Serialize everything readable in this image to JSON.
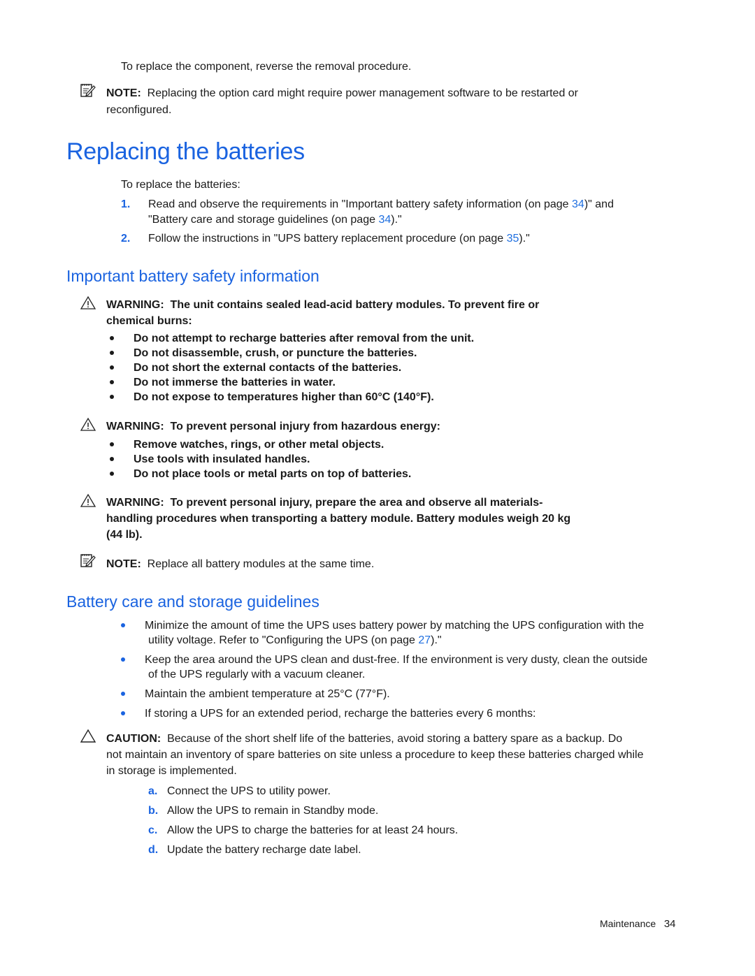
{
  "intro": "To replace the component, reverse the removal procedure.",
  "note1": {
    "label": "NOTE:",
    "text": "Replacing the option card might require power management software to be restarted or",
    "text2": "reconfigured."
  },
  "section1": {
    "title": "Replacing the batteries",
    "lead": "To replace the batteries:",
    "steps": [
      {
        "num": "1.",
        "pre": "Read and observe the requirements in \"Important battery safety information (on page ",
        "link": "34",
        "post": ")\" and",
        "line2_pre": "\"Battery care and storage guidelines (on page ",
        "line2_link": "34",
        "line2_post": ").\""
      },
      {
        "num": "2.",
        "pre": "Follow the instructions in \"UPS battery replacement procedure (on page ",
        "link": "35",
        "post": ").\""
      }
    ]
  },
  "section2": {
    "title": "Important battery safety information",
    "warning1": {
      "label": "WARNING:",
      "text": "The unit contains sealed lead-acid battery modules. To prevent fire or",
      "text2": "chemical burns:",
      "items": [
        "Do not attempt to recharge batteries after removal from the unit.",
        "Do not disassemble, crush, or puncture the batteries.",
        "Do not short the external contacts of the batteries.",
        "Do not immerse the batteries in water.",
        "Do not expose to temperatures higher than 60°C (140°F)."
      ]
    },
    "warning2": {
      "label": "WARNING:",
      "text": "To prevent personal injury from hazardous energy:",
      "items": [
        "Remove watches, rings, or other metal objects.",
        "Use tools with insulated handles.",
        "Do not place tools or metal parts on top of batteries."
      ]
    },
    "warning3": {
      "label": "WARNING:",
      "text": "To prevent personal injury, prepare the area and observe all materials-",
      "text2": "handling procedures when transporting a battery module. Battery modules weigh 20 kg",
      "text3": "(44 lb)."
    },
    "note": {
      "label": "NOTE:",
      "text": "Replace all battery modules at the same time."
    }
  },
  "section3": {
    "title": "Battery care and storage guidelines",
    "bullets": [
      {
        "l1": "Minimize the amount of time the UPS uses battery power by matching the UPS configuration with the",
        "l2_pre": "utility voltage. Refer to \"Configuring the UPS (on page ",
        "l2_link": "27",
        "l2_post": ").\""
      },
      {
        "l1": "Keep the area around the UPS clean and dust-free. If the environment is very dusty, clean the outside",
        "l2": "of the UPS regularly with a vacuum cleaner."
      },
      {
        "l1": "Maintain the ambient temperature at 25°C (77°F)."
      },
      {
        "l1": "If storing a UPS for an extended period, recharge the batteries every 6 months:"
      }
    ],
    "caution": {
      "label": "CAUTION:",
      "text": "Because of the short shelf life of the batteries, avoid storing a battery spare as a backup. Do",
      "text2": "not maintain an inventory of spare batteries on site unless a procedure to keep these batteries charged while",
      "text3": "in storage is implemented."
    },
    "substeps": [
      {
        "letter": "a.",
        "text": "Connect the UPS to utility power."
      },
      {
        "letter": "b.",
        "text": "Allow the UPS to remain in Standby mode."
      },
      {
        "letter": "c.",
        "text": "Allow the UPS to charge the batteries for at least 24 hours."
      },
      {
        "letter": "d.",
        "text": "Update the battery recharge date label."
      }
    ]
  },
  "footer": {
    "section": "Maintenance",
    "page": "34"
  }
}
